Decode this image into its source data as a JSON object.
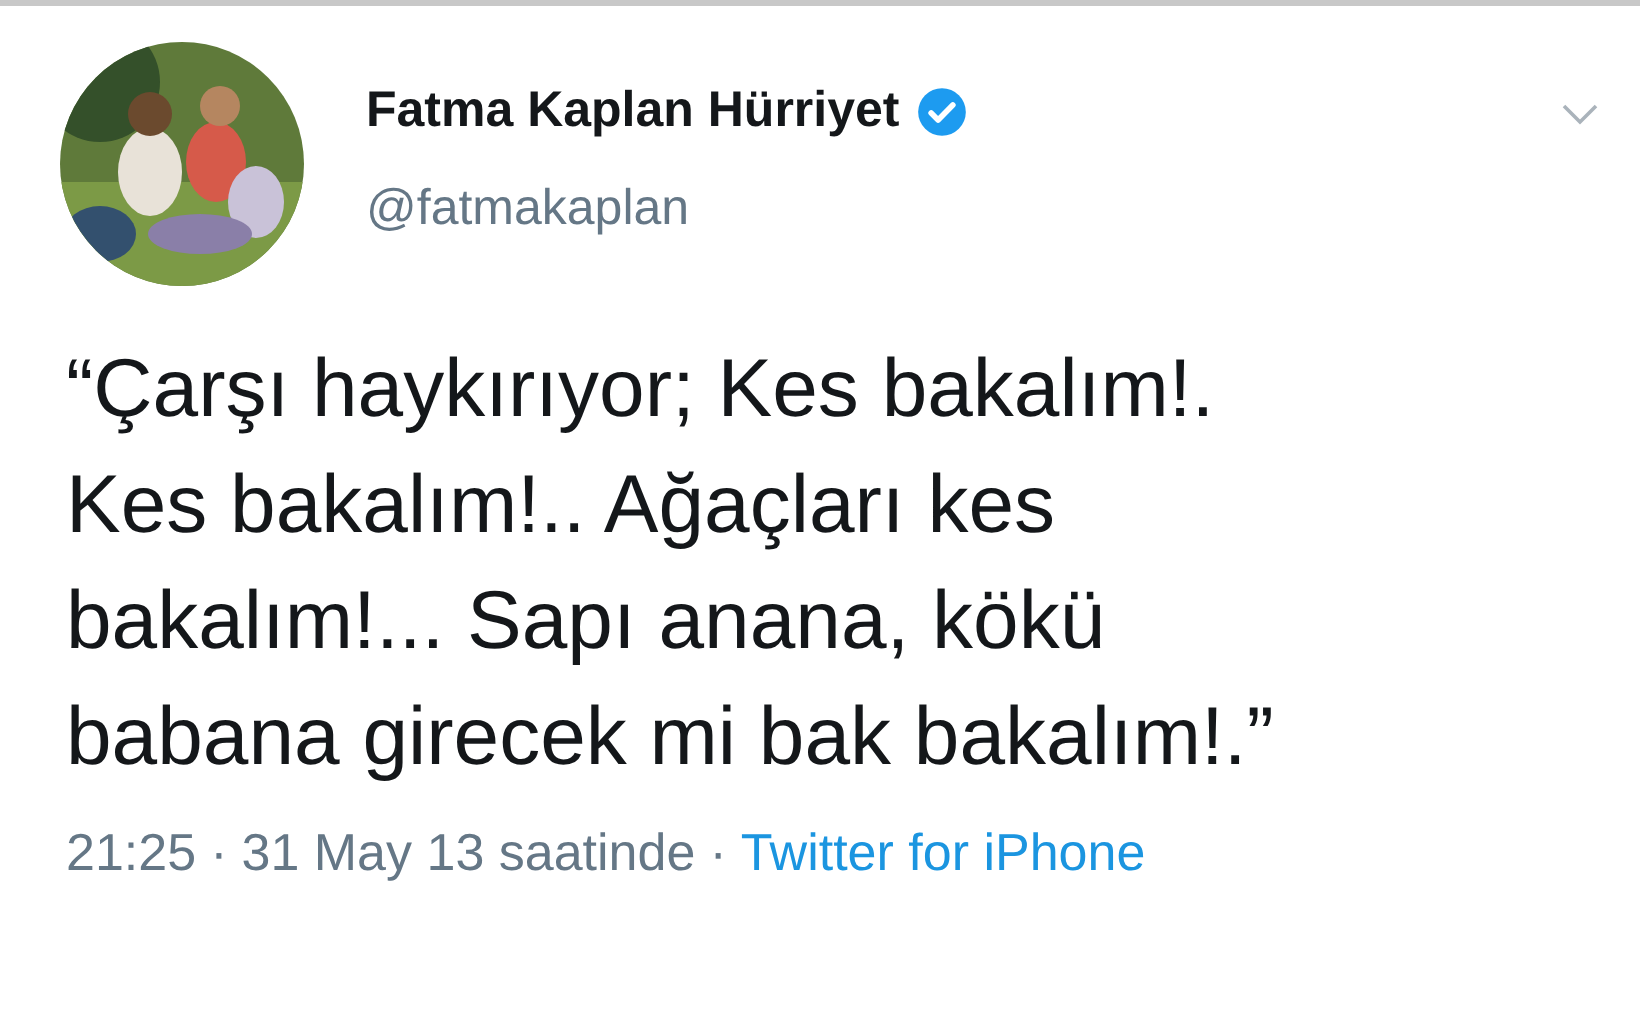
{
  "author": {
    "name": "Fatma Kaplan Hürriyet",
    "verified": true,
    "handle": "@fatmakaplan"
  },
  "tweet": {
    "lines": [
      "“Çarşı haykırıyor; Kes bakalım!.",
      "Kes bakalım!.. Ağaçları kes",
      "bakalım!... Sapı anana, kökü",
      "babana girecek mi bak bakalım!.”"
    ]
  },
  "footer": {
    "time": "21:25",
    "separator": "·",
    "date": "31 May 13 saatinde",
    "separator_2": "·",
    "source": "Twitter for iPhone"
  }
}
